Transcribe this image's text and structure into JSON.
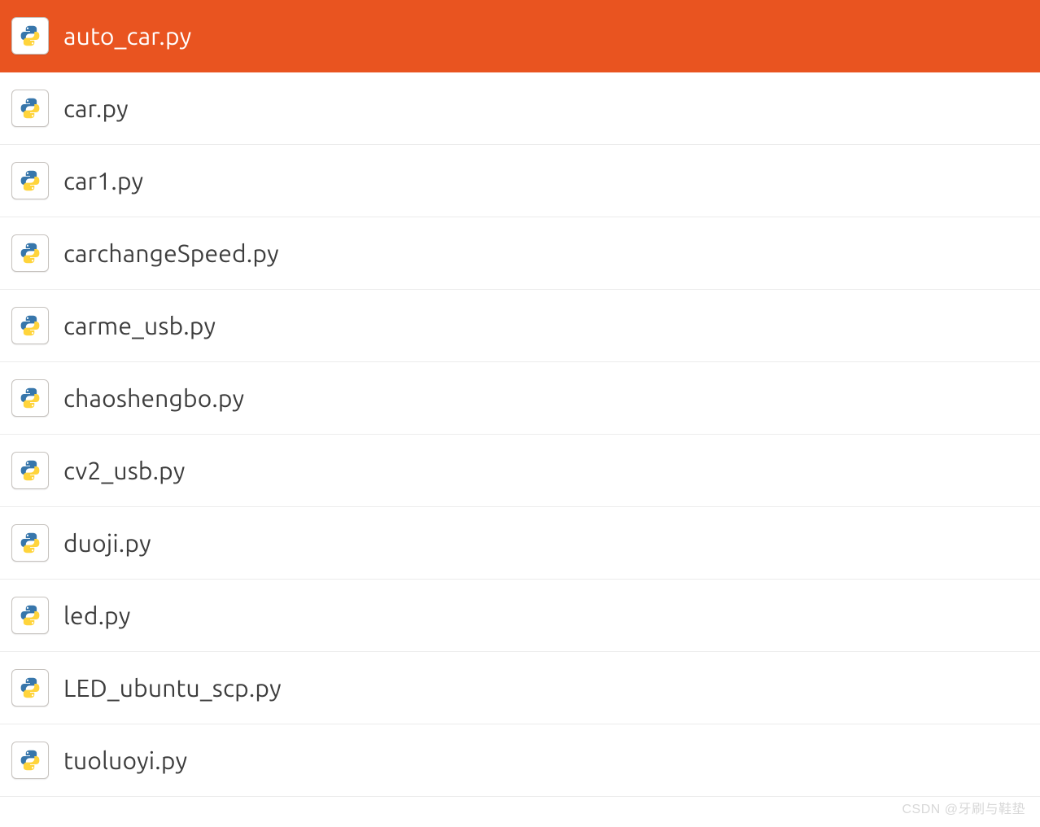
{
  "files": [
    {
      "name": "auto_car.py",
      "selected": true
    },
    {
      "name": "car.py",
      "selected": false
    },
    {
      "name": "car1.py",
      "selected": false
    },
    {
      "name": "carchangeSpeed.py",
      "selected": false
    },
    {
      "name": "carme_usb.py",
      "selected": false
    },
    {
      "name": "chaoshengbo.py",
      "selected": false
    },
    {
      "name": "cv2_usb.py",
      "selected": false
    },
    {
      "name": "duoji.py",
      "selected": false
    },
    {
      "name": "led.py",
      "selected": false
    },
    {
      "name": "LED_ubuntu_scp.py",
      "selected": false
    },
    {
      "name": "tuoluoyi.py",
      "selected": false
    }
  ],
  "watermark": "CSDN @牙刷与鞋垫"
}
